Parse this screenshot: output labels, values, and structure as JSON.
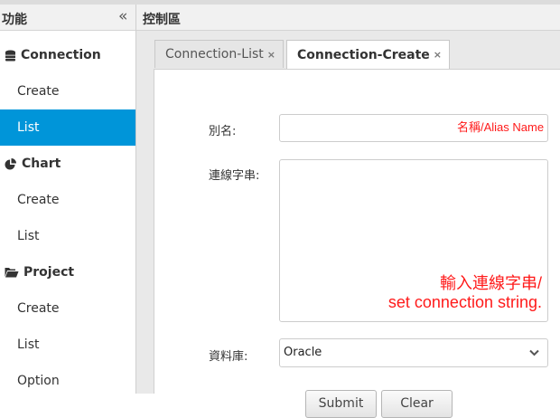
{
  "sidebar": {
    "title": "功能",
    "collapse_icon": "double-chevron-left-icon",
    "groups": [
      {
        "title": "Connection",
        "icon": "database-icon",
        "items": [
          "Create",
          "List"
        ]
      },
      {
        "title": "Chart",
        "icon": "pie-chart-icon",
        "items": [
          "Create",
          "List"
        ]
      },
      {
        "title": "Project",
        "icon": "folder-open-icon",
        "items": [
          "Create",
          "List",
          "Option"
        ]
      }
    ],
    "active_item": "Connection/List"
  },
  "main": {
    "title": "控制區",
    "tabs": [
      {
        "label": "Connection-List",
        "active": false
      },
      {
        "label": "Connection-Create",
        "active": true
      }
    ],
    "tab_close_glyph": "×",
    "form": {
      "alias_label": "別名:",
      "alias_value": "",
      "alias_annotation": "名稱/Alias Name",
      "conn_label": "連線字串:",
      "conn_value": "",
      "conn_annotation_line1": "輸入連線字串/",
      "conn_annotation_line2": "set connection string.",
      "db_label": "資料庫:",
      "db_value": "Oracle",
      "submit_label": "Submit",
      "clear_label": "Clear"
    }
  },
  "colors": {
    "active_item_bg": "#0095d9",
    "annotation": "#ff1a1a",
    "header_bg": "#f1f1f1",
    "body_bg": "#e9e9e9"
  }
}
